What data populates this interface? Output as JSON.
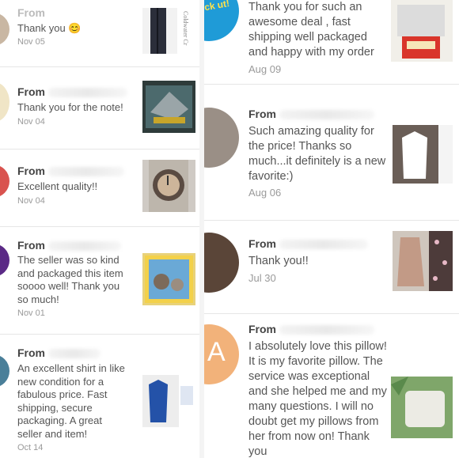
{
  "left_reviews": [
    {
      "from_prefix": "From",
      "text": "Thank you",
      "emoji": "😊",
      "date": "Nov 05",
      "thumb_caption": "Coldwater Cr"
    },
    {
      "from_prefix": "From",
      "text": "Thank you for the note!",
      "date": "Nov 04"
    },
    {
      "from_prefix": "From",
      "text": "Excellent quality!!",
      "date": "Nov 04"
    },
    {
      "from_prefix": "From",
      "text": "The seller was so kind and packaged this item soooo well! Thank you so much!",
      "date": "Nov 01"
    },
    {
      "from_prefix": "From",
      "text": "An excellent shirt in like new condition for a fabulous price. Fast shipping, secure packaging. A great seller and item!",
      "date": "Oct 14"
    }
  ],
  "right_reviews": [
    {
      "from_prefix": "",
      "text": "Thank you for such an awesome deal , fast shipping well packaged and happy with my order",
      "date": "Aug 09",
      "avatar_text": "ck ut!"
    },
    {
      "from_prefix": "From",
      "text": "Such amazing quality for the price! Thanks so much...it definitely is a new favorite:)",
      "date": "Aug 06"
    },
    {
      "from_prefix": "From",
      "text": "Thank you!!",
      "date": "Jul 30"
    },
    {
      "from_prefix": "From",
      "text": "I absolutely love this pillow! It is my favorite pillow. The service was exceptional and she helped me and my many questions. I will no doubt get my pillows from her from now on! Thank you",
      "date": "",
      "avatar_letter": "A"
    }
  ],
  "colors": {
    "avatar_red": "#d9534f",
    "avatar_purple": "#5b2a86",
    "avatar_teal": "#4a7f99",
    "avatar_peach": "#f2b27a"
  }
}
